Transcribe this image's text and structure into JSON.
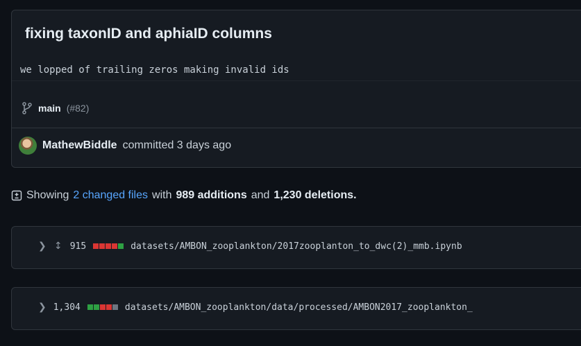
{
  "commit": {
    "title": "fixing taxonID and aphiaID columns",
    "description": "we lopped of trailing zeros making invalid ids",
    "branch": "main",
    "pr_ref": "(#82)",
    "author": "MathewBiddle",
    "committed_text": "committed 3 days ago"
  },
  "summary": {
    "prefix": "Showing",
    "changed_files": "2 changed files",
    "with": "with",
    "additions": "989 additions",
    "and": "and",
    "deletions": "1,230 deletions."
  },
  "files": [
    {
      "count": "915",
      "path": "datasets/AMBON_zooplankton/2017zooplanton_to_dwc(2)_mmb.ipynb",
      "diffstat": [
        "#da3633",
        "#da3633",
        "#da3633",
        "#da3633",
        "#2ea043"
      ]
    },
    {
      "count": "1,304",
      "path": "datasets/AMBON_zooplankton/data/processed/AMBON2017_zooplankton_",
      "diffstat": [
        "#2ea043",
        "#2ea043",
        "#da3633",
        "#da3633",
        "#6e7681"
      ]
    }
  ],
  "colors": {
    "background": "#0d1117",
    "link": "#58a6ff",
    "addition": "#2ea043",
    "deletion": "#da3633"
  },
  "icons": {
    "branch": "git-branch-icon",
    "summary": "file-diff-icon",
    "chevron": "chevron-right-icon",
    "expand": "unfold-icon"
  }
}
